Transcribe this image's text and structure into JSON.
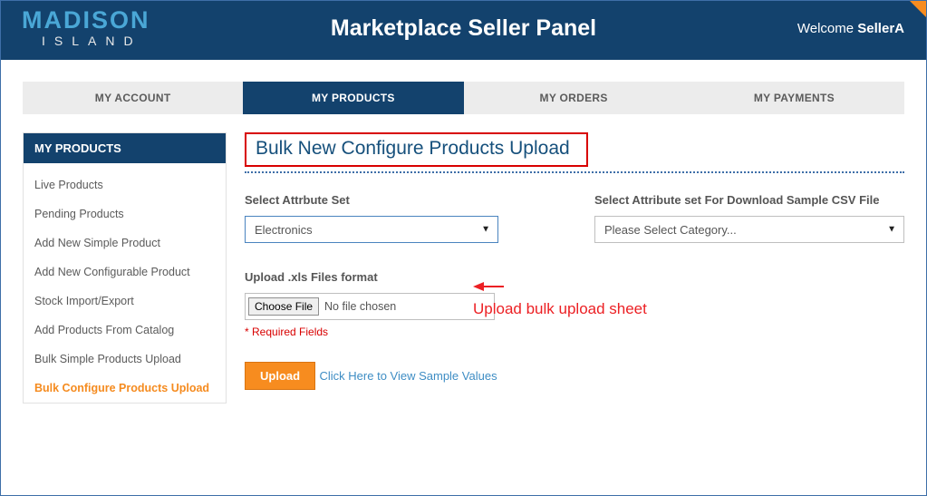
{
  "header": {
    "logo_top": "MADISON",
    "logo_bottom": "ISLAND",
    "title": "Marketplace Seller Panel",
    "welcome_prefix": "Welcome ",
    "welcome_user": "SellerA"
  },
  "topnav": {
    "items": [
      {
        "label": "MY ACCOUNT",
        "active": false
      },
      {
        "label": "MY PRODUCTS",
        "active": true
      },
      {
        "label": "MY ORDERS",
        "active": false
      },
      {
        "label": "MY PAYMENTS",
        "active": false
      }
    ]
  },
  "sidebar": {
    "title": "MY PRODUCTS",
    "items": [
      {
        "label": "Live Products",
        "active": false
      },
      {
        "label": "Pending Products",
        "active": false
      },
      {
        "label": "Add New Simple Product",
        "active": false
      },
      {
        "label": "Add New Configurable Product",
        "active": false
      },
      {
        "label": "Stock Import/Export",
        "active": false
      },
      {
        "label": "Add Products From Catalog",
        "active": false
      },
      {
        "label": "Bulk Simple Products Upload",
        "active": false
      },
      {
        "label": "Bulk Configure Products Upload",
        "active": true
      }
    ]
  },
  "main": {
    "page_title": "Bulk New Configure Products Upload",
    "attr_set_label": "Select Attrbute Set",
    "attr_set_value": "Electronics",
    "sample_csv_label": "Select Attribute set For Download Sample CSV File",
    "sample_csv_value": "Please Select Category...",
    "upload_label": "Upload .xls Files format",
    "choose_file_btn": "Choose File",
    "no_file_text": "No file chosen",
    "required_text": "* Required Fields",
    "upload_btn": "Upload",
    "sample_link": "Click Here to View Sample Values"
  },
  "annotation": {
    "text": "Upload bulk upload sheet"
  }
}
